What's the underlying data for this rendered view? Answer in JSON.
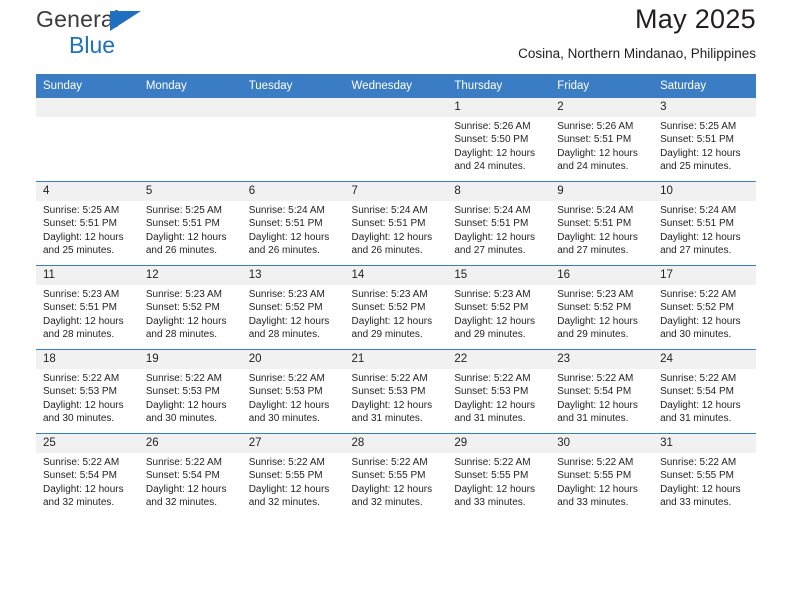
{
  "brand": {
    "name_top": "General",
    "name_bottom": "Blue",
    "accent_color": "#1f70c1"
  },
  "header": {
    "title": "May 2025",
    "subtitle": "Cosina, Northern Mindanao, Philippines"
  },
  "calendar": {
    "header_bg": "#3b7dc4",
    "daynum_bg": "#f1f1f1",
    "weekday_headers": [
      "Sunday",
      "Monday",
      "Tuesday",
      "Wednesday",
      "Thursday",
      "Friday",
      "Saturday"
    ],
    "weeks": [
      [
        {
          "day": "",
          "lines": []
        },
        {
          "day": "",
          "lines": []
        },
        {
          "day": "",
          "lines": []
        },
        {
          "day": "",
          "lines": []
        },
        {
          "day": "1",
          "lines": [
            "Sunrise: 5:26 AM",
            "Sunset: 5:50 PM",
            "Daylight: 12 hours and 24 minutes."
          ]
        },
        {
          "day": "2",
          "lines": [
            "Sunrise: 5:26 AM",
            "Sunset: 5:51 PM",
            "Daylight: 12 hours and 24 minutes."
          ]
        },
        {
          "day": "3",
          "lines": [
            "Sunrise: 5:25 AM",
            "Sunset: 5:51 PM",
            "Daylight: 12 hours and 25 minutes."
          ]
        }
      ],
      [
        {
          "day": "4",
          "lines": [
            "Sunrise: 5:25 AM",
            "Sunset: 5:51 PM",
            "Daylight: 12 hours and 25 minutes."
          ]
        },
        {
          "day": "5",
          "lines": [
            "Sunrise: 5:25 AM",
            "Sunset: 5:51 PM",
            "Daylight: 12 hours and 26 minutes."
          ]
        },
        {
          "day": "6",
          "lines": [
            "Sunrise: 5:24 AM",
            "Sunset: 5:51 PM",
            "Daylight: 12 hours and 26 minutes."
          ]
        },
        {
          "day": "7",
          "lines": [
            "Sunrise: 5:24 AM",
            "Sunset: 5:51 PM",
            "Daylight: 12 hours and 26 minutes."
          ]
        },
        {
          "day": "8",
          "lines": [
            "Sunrise: 5:24 AM",
            "Sunset: 5:51 PM",
            "Daylight: 12 hours and 27 minutes."
          ]
        },
        {
          "day": "9",
          "lines": [
            "Sunrise: 5:24 AM",
            "Sunset: 5:51 PM",
            "Daylight: 12 hours and 27 minutes."
          ]
        },
        {
          "day": "10",
          "lines": [
            "Sunrise: 5:24 AM",
            "Sunset: 5:51 PM",
            "Daylight: 12 hours and 27 minutes."
          ]
        }
      ],
      [
        {
          "day": "11",
          "lines": [
            "Sunrise: 5:23 AM",
            "Sunset: 5:51 PM",
            "Daylight: 12 hours and 28 minutes."
          ]
        },
        {
          "day": "12",
          "lines": [
            "Sunrise: 5:23 AM",
            "Sunset: 5:52 PM",
            "Daylight: 12 hours and 28 minutes."
          ]
        },
        {
          "day": "13",
          "lines": [
            "Sunrise: 5:23 AM",
            "Sunset: 5:52 PM",
            "Daylight: 12 hours and 28 minutes."
          ]
        },
        {
          "day": "14",
          "lines": [
            "Sunrise: 5:23 AM",
            "Sunset: 5:52 PM",
            "Daylight: 12 hours and 29 minutes."
          ]
        },
        {
          "day": "15",
          "lines": [
            "Sunrise: 5:23 AM",
            "Sunset: 5:52 PM",
            "Daylight: 12 hours and 29 minutes."
          ]
        },
        {
          "day": "16",
          "lines": [
            "Sunrise: 5:23 AM",
            "Sunset: 5:52 PM",
            "Daylight: 12 hours and 29 minutes."
          ]
        },
        {
          "day": "17",
          "lines": [
            "Sunrise: 5:22 AM",
            "Sunset: 5:52 PM",
            "Daylight: 12 hours and 30 minutes."
          ]
        }
      ],
      [
        {
          "day": "18",
          "lines": [
            "Sunrise: 5:22 AM",
            "Sunset: 5:53 PM",
            "Daylight: 12 hours and 30 minutes."
          ]
        },
        {
          "day": "19",
          "lines": [
            "Sunrise: 5:22 AM",
            "Sunset: 5:53 PM",
            "Daylight: 12 hours and 30 minutes."
          ]
        },
        {
          "day": "20",
          "lines": [
            "Sunrise: 5:22 AM",
            "Sunset: 5:53 PM",
            "Daylight: 12 hours and 30 minutes."
          ]
        },
        {
          "day": "21",
          "lines": [
            "Sunrise: 5:22 AM",
            "Sunset: 5:53 PM",
            "Daylight: 12 hours and 31 minutes."
          ]
        },
        {
          "day": "22",
          "lines": [
            "Sunrise: 5:22 AM",
            "Sunset: 5:53 PM",
            "Daylight: 12 hours and 31 minutes."
          ]
        },
        {
          "day": "23",
          "lines": [
            "Sunrise: 5:22 AM",
            "Sunset: 5:54 PM",
            "Daylight: 12 hours and 31 minutes."
          ]
        },
        {
          "day": "24",
          "lines": [
            "Sunrise: 5:22 AM",
            "Sunset: 5:54 PM",
            "Daylight: 12 hours and 31 minutes."
          ]
        }
      ],
      [
        {
          "day": "25",
          "lines": [
            "Sunrise: 5:22 AM",
            "Sunset: 5:54 PM",
            "Daylight: 12 hours and 32 minutes."
          ]
        },
        {
          "day": "26",
          "lines": [
            "Sunrise: 5:22 AM",
            "Sunset: 5:54 PM",
            "Daylight: 12 hours and 32 minutes."
          ]
        },
        {
          "day": "27",
          "lines": [
            "Sunrise: 5:22 AM",
            "Sunset: 5:55 PM",
            "Daylight: 12 hours and 32 minutes."
          ]
        },
        {
          "day": "28",
          "lines": [
            "Sunrise: 5:22 AM",
            "Sunset: 5:55 PM",
            "Daylight: 12 hours and 32 minutes."
          ]
        },
        {
          "day": "29",
          "lines": [
            "Sunrise: 5:22 AM",
            "Sunset: 5:55 PM",
            "Daylight: 12 hours and 33 minutes."
          ]
        },
        {
          "day": "30",
          "lines": [
            "Sunrise: 5:22 AM",
            "Sunset: 5:55 PM",
            "Daylight: 12 hours and 33 minutes."
          ]
        },
        {
          "day": "31",
          "lines": [
            "Sunrise: 5:22 AM",
            "Sunset: 5:55 PM",
            "Daylight: 12 hours and 33 minutes."
          ]
        }
      ]
    ]
  }
}
